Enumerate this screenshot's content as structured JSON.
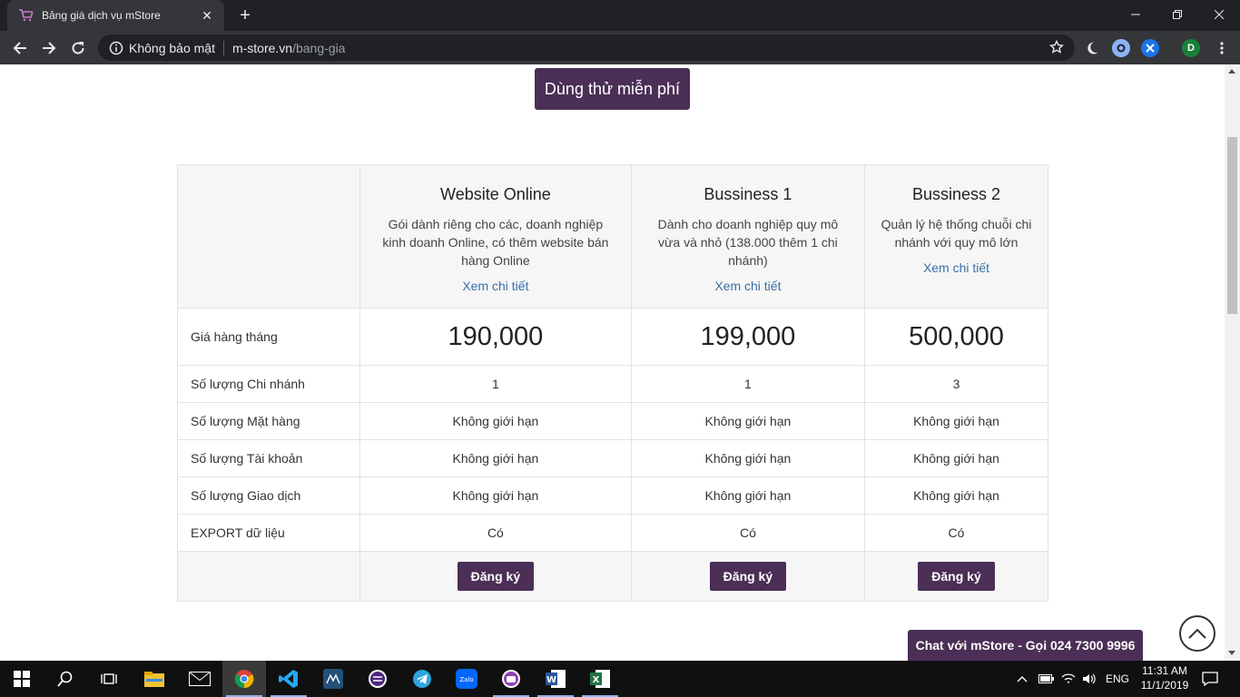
{
  "browser": {
    "tab_title": "Bảng giá dịch vụ mStore",
    "security_label": "Không bảo mật",
    "url_host": "m-store.vn",
    "url_path": "/bang-gia",
    "profile_initial": "D"
  },
  "page": {
    "trial_button": "Dùng thử miễn phí",
    "plans": [
      {
        "name": "Website Online",
        "desc": "Gói dành riêng cho các, doanh nghiệp kinh doanh Online, có thêm website bán hàng Online",
        "link": "Xem chi tiết"
      },
      {
        "name": "Bussiness 1",
        "desc": "Dành cho doanh nghiệp quy mô vừa và nhỏ (138.000 thêm 1 chi nhánh)",
        "link": "Xem chi tiết"
      },
      {
        "name": "Bussiness 2",
        "desc": "Quản lý hệ thống chuỗi chi nhánh với quy mô lớn",
        "link": "Xem chi tiết"
      }
    ],
    "rows": [
      {
        "label": "Giá hàng tháng",
        "values": [
          "190,000",
          "199,000",
          "500,000"
        ]
      },
      {
        "label": "Số lượng Chi nhánh",
        "values": [
          "1",
          "1",
          "3"
        ]
      },
      {
        "label": "Số lượng Mặt hàng",
        "values": [
          "Không giới hạn",
          "Không giới hạn",
          "Không giới hạn"
        ]
      },
      {
        "label": "Số lượng Tài khoản",
        "values": [
          "Không giới hạn",
          "Không giới hạn",
          "Không giới hạn"
        ]
      },
      {
        "label": "Số lượng Giao dịch",
        "values": [
          "Không giới hạn",
          "Không giới hạn",
          "Không giới hạn"
        ]
      },
      {
        "label": "EXPORT dữ liệu",
        "values": [
          "Có",
          "Có",
          "Có"
        ]
      }
    ],
    "register_label": "Đăng ký",
    "chat_label": "Chat với mStore - Gọi 024 7300 9996"
  },
  "taskbar": {
    "language": "ENG",
    "time": "11:31 AM",
    "date": "11/1/2019"
  },
  "colors": {
    "brand": "#4b2f56",
    "link": "#3a6fa8"
  }
}
